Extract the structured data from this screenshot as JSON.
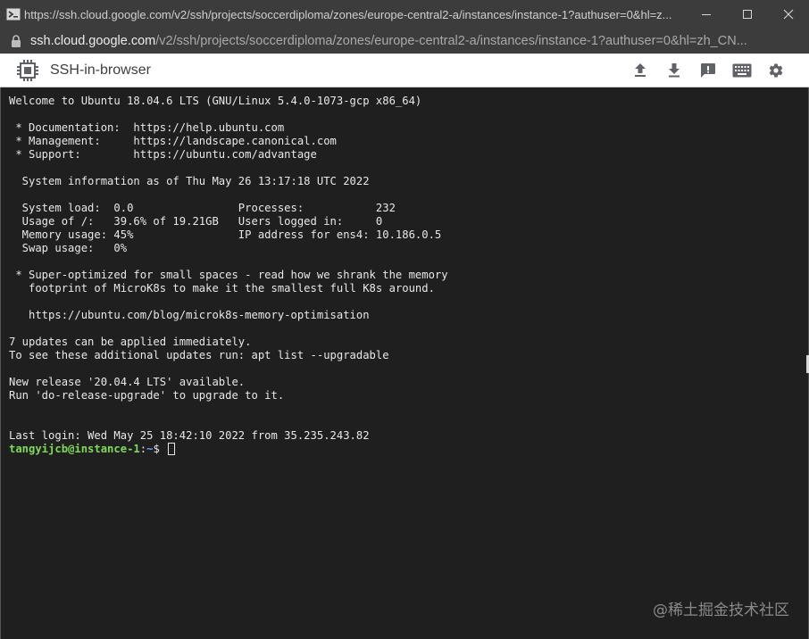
{
  "window": {
    "title": "https://ssh.cloud.google.com/v2/ssh/projects/soccerdiploma/zones/europe-central2-a/instances/instance-1?authuser=0&hl=z...",
    "controls": [
      "minimize",
      "maximize",
      "close"
    ]
  },
  "address_bar": {
    "host": "ssh.cloud.google.com",
    "path": "/v2/ssh/projects/soccerdiploma/zones/europe-central2-a/instances/instance-1?authuser=0&hl=zh_CN..."
  },
  "app_bar": {
    "title": "SSH-in-browser",
    "tools": [
      "upload-icon",
      "download-icon",
      "feedback-icon",
      "keyboard-icon",
      "settings-icon"
    ]
  },
  "terminal": {
    "lines": [
      "Welcome to Ubuntu 18.04.6 LTS (GNU/Linux 5.4.0-1073-gcp x86_64)",
      "",
      " * Documentation:  https://help.ubuntu.com",
      " * Management:     https://landscape.canonical.com",
      " * Support:        https://ubuntu.com/advantage",
      "",
      "  System information as of Thu May 26 13:17:18 UTC 2022",
      "",
      "  System load:  0.0                Processes:           232",
      "  Usage of /:   39.6% of 19.21GB   Users logged in:     0",
      "  Memory usage: 45%                IP address for ens4: 10.186.0.5",
      "  Swap usage:   0%",
      "",
      " * Super-optimized for small spaces - read how we shrank the memory",
      "   footprint of MicroK8s to make it the smallest full K8s around.",
      "",
      "   https://ubuntu.com/blog/microk8s-memory-optimisation",
      "",
      "7 updates can be applied immediately.",
      "To see these additional updates run: apt list --upgradable",
      "",
      "New release '20.04.4 LTS' available.",
      "Run 'do-release-upgrade' to upgrade to it.",
      "",
      "",
      "Last login: Wed May 25 18:42:10 2022 from 35.235.243.82"
    ],
    "prompt": {
      "user_host": "tangyijcb@instance-1",
      "separator": ":",
      "path": "~",
      "symbol": "$ "
    }
  },
  "watermark": "@稀土掘金技术社区",
  "colors": {
    "titlebar": "#3c3c3c",
    "terminal_bg": "#1f1f1f",
    "prompt_user": "#7ed957",
    "prompt_path": "#5da9ff"
  }
}
